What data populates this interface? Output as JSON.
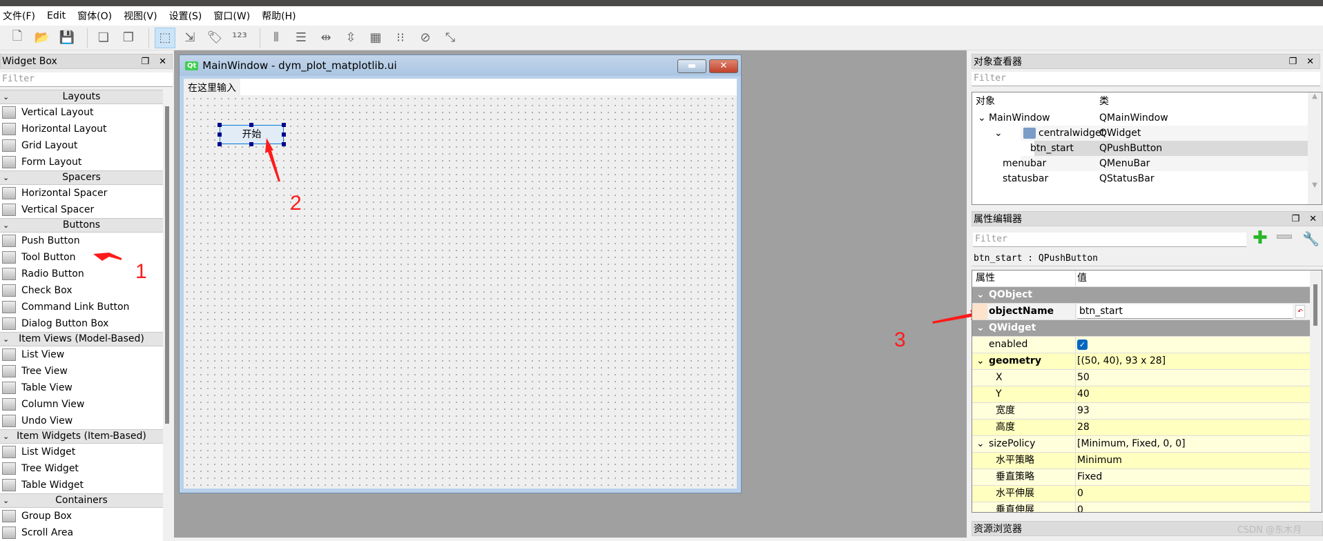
{
  "menu": [
    "文件(F)",
    "Edit",
    "窗体(O)",
    "视图(V)",
    "设置(S)",
    "窗口(W)",
    "帮助(H)"
  ],
  "toolbar": [
    "new-icon",
    "open-icon",
    "save-icon",
    "send-to-back-icon",
    "bring-to-front-icon",
    "edit-widgets-icon",
    "edit-signals-slots-icon",
    "edit-buddies-icon",
    "edit-tab-order-icon",
    "lay-out-horizontally-icon",
    "lay-out-vertically-icon",
    "horizontal-splitter-icon",
    "vertical-splitter-icon",
    "grid-layout-icon",
    "form-layout-icon",
    "break-layout-icon",
    "adjust-size-icon"
  ],
  "widget_box": {
    "title": "Widget Box",
    "filter_placeholder": "Filter",
    "sections": [
      {
        "label": "Layouts",
        "items": [
          "Vertical Layout",
          "Horizontal Layout",
          "Grid Layout",
          "Form Layout"
        ]
      },
      {
        "label": "Spacers",
        "items": [
          "Horizontal Spacer",
          "Vertical Spacer"
        ]
      },
      {
        "label": "Buttons",
        "items": [
          "Push Button",
          "Tool Button",
          "Radio Button",
          "Check Box",
          "Command Link Button",
          "Dialog Button Box"
        ]
      },
      {
        "label": "Item Views (Model-Based)",
        "items": [
          "List View",
          "Tree View",
          "Table View",
          "Column View",
          "Undo View"
        ]
      },
      {
        "label": "Item Widgets (Item-Based)",
        "items": [
          "List Widget",
          "Tree Widget",
          "Table Widget"
        ]
      },
      {
        "label": "Containers",
        "items": [
          "Group Box",
          "Scroll Area"
        ]
      }
    ]
  },
  "form": {
    "title": "MainWindow - dym_plot_matplotlib.ui",
    "menu_placeholder": "在这里输入",
    "button_text": "开始"
  },
  "annotations": [
    "1",
    "2",
    "3"
  ],
  "object_inspector": {
    "title": "对象查看器",
    "filter_placeholder": "Filter",
    "col_object": "对象",
    "col_class": "类",
    "rows": [
      {
        "name": "MainWindow",
        "cls": "QMainWindow"
      },
      {
        "name": "centralwidget",
        "cls": "QWidget"
      },
      {
        "name": "btn_start",
        "cls": "QPushButton"
      },
      {
        "name": "menubar",
        "cls": "QMenuBar"
      },
      {
        "name": "statusbar",
        "cls": "QStatusBar"
      }
    ]
  },
  "property_editor": {
    "title": "属性编辑器",
    "filter_placeholder": "Filter",
    "object_label": "btn_start : QPushButton",
    "col_property": "属性",
    "col_value": "值",
    "rows": [
      {
        "k": "QObject",
        "v": "",
        "t": "group"
      },
      {
        "k": "objectName",
        "v": "btn_start",
        "t": "edit"
      },
      {
        "k": "QWidget",
        "v": "",
        "t": "group"
      },
      {
        "k": "enabled",
        "v": "",
        "t": "check"
      },
      {
        "k": "geometry",
        "v": "[(50, 40), 93 x 28]",
        "t": "bold"
      },
      {
        "k": "X",
        "v": "50",
        "t": "sub"
      },
      {
        "k": "Y",
        "v": "40",
        "t": "sub"
      },
      {
        "k": "宽度",
        "v": "93",
        "t": "sub"
      },
      {
        "k": "高度",
        "v": "28",
        "t": "sub"
      },
      {
        "k": "sizePolicy",
        "v": "[Minimum, Fixed, 0, 0]",
        "t": "exp"
      },
      {
        "k": "水平策略",
        "v": "Minimum",
        "t": "sub"
      },
      {
        "k": "垂直策略",
        "v": "Fixed",
        "t": "sub"
      },
      {
        "k": "水平伸展",
        "v": "0",
        "t": "sub"
      },
      {
        "k": "垂直伸展",
        "v": "0",
        "t": "sub"
      }
    ]
  },
  "resource_browser": {
    "title": "资源浏览器"
  },
  "watermark": "CSDN @东木月"
}
